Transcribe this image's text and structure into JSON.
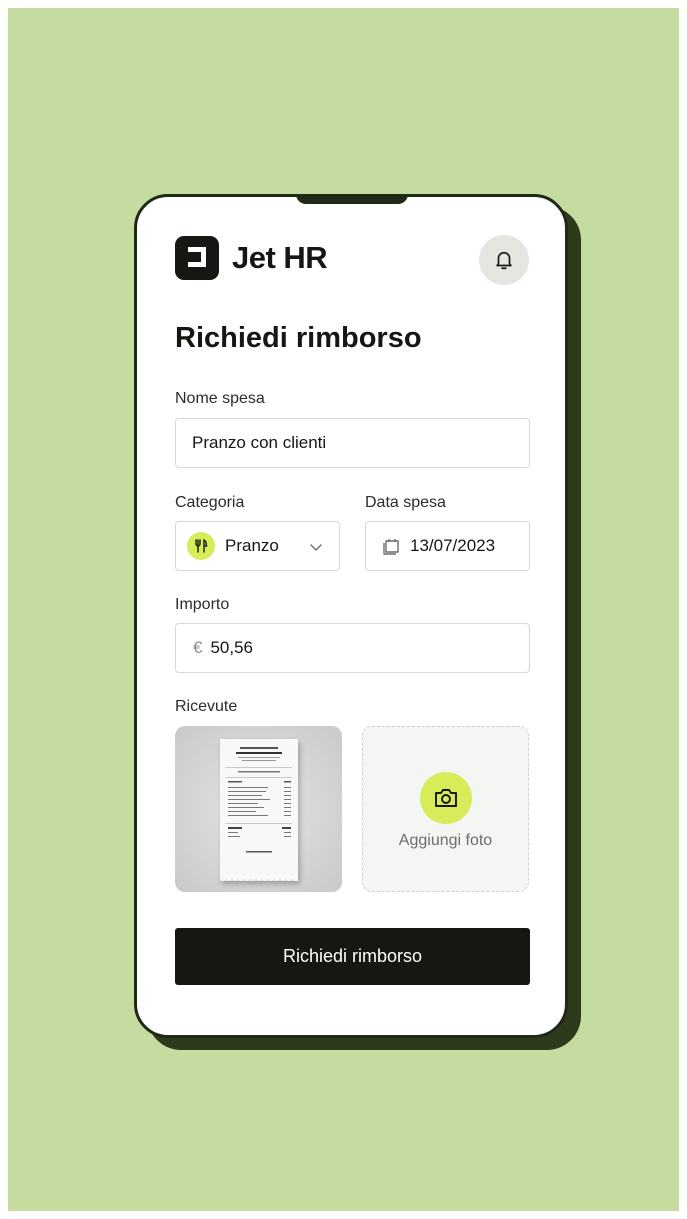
{
  "app": {
    "brand": "Jet HR"
  },
  "page": {
    "title": "Richiedi rimborso"
  },
  "form": {
    "name_label": "Nome spesa",
    "name_value": "Pranzo con clienti",
    "category_label": "Categoria",
    "category_value": "Pranzo",
    "date_label": "Data spesa",
    "date_value": "13/07/2023",
    "amount_label": "Importo",
    "currency_symbol": "€",
    "amount_value": "50,56",
    "receipts_label": "Ricevute",
    "add_photo_label": "Aggiungi foto",
    "submit_label": "Richiedi rimborso"
  },
  "icons": {
    "notification": "bell-icon",
    "category": "fork-knife-icon",
    "dropdown": "chevron-down-icon",
    "date": "calendar-icon",
    "add_photo": "camera-icon"
  },
  "colors": {
    "background": "#c5dca1",
    "accent": "#d8ec5a",
    "primary": "#151812"
  }
}
